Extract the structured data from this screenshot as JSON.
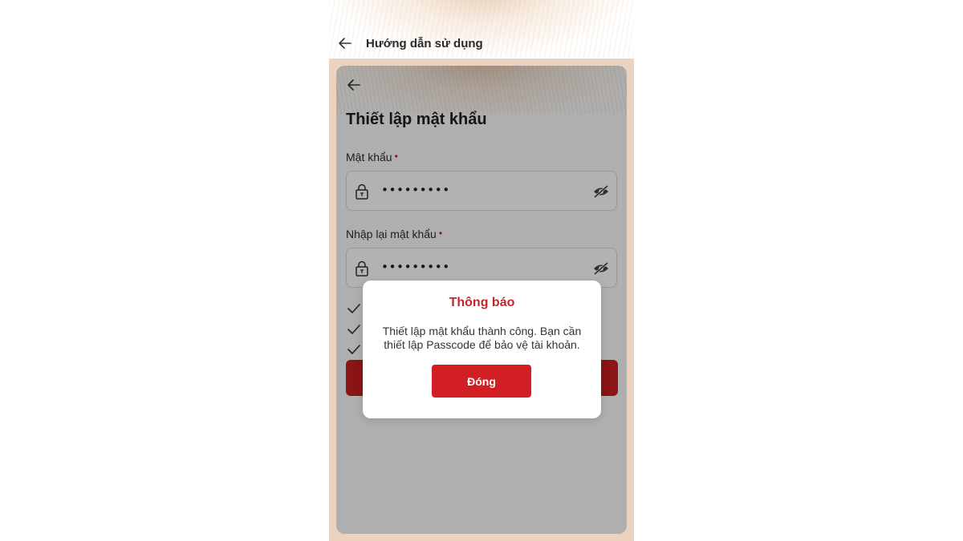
{
  "outer_header": {
    "title": "Hướng dẫn sử dụng"
  },
  "screen": {
    "title": "Thiết lập mật khẩu",
    "password": {
      "label": "Mật khẩu",
      "required_mark": "•",
      "value": "•••••••••"
    },
    "confirm_password": {
      "label": "Nhập lại mật khẩu",
      "required_mark": "•",
      "value": "•••••••••"
    }
  },
  "dialog": {
    "title": "Thông báo",
    "message": "Thiết lập mật khẩu thành công. Bạn cần thiết lập Passcode để bảo vệ tài khoản.",
    "close_label": "Đóng"
  },
  "icons": {
    "back": "arrow-left-icon",
    "lock": "lock-icon",
    "eye": "eye-off-icon",
    "check": "check-icon"
  },
  "colors": {
    "accent": "#c81e1e",
    "dialog_title": "#c0272d",
    "frame_bg": "#ebd3bf"
  }
}
